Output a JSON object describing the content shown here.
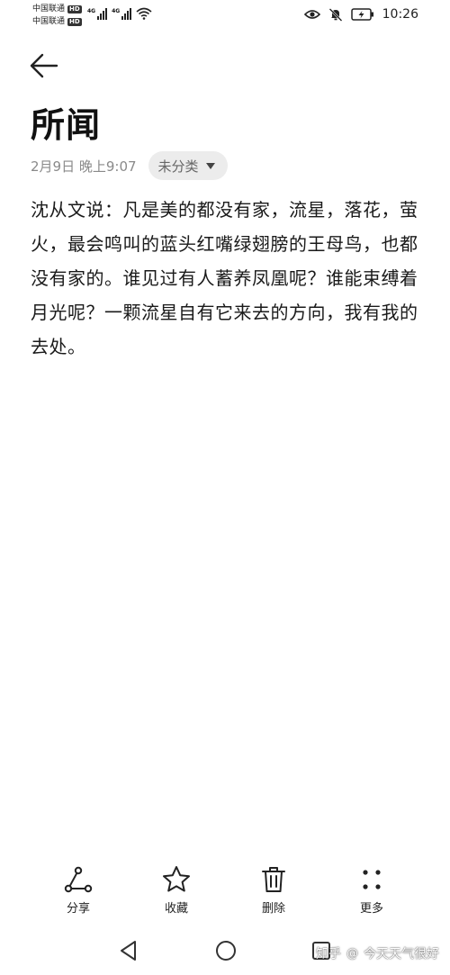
{
  "status_bar": {
    "carrier_1": "中国联通",
    "carrier_2": "中国联通",
    "hd_badge": "HD",
    "network": "4G",
    "time": "10:26"
  },
  "note": {
    "title": "所闻",
    "date": "2月9日 晚上9:07",
    "category": "未分类",
    "body": "沈从文说：凡是美的都没有家，流星，落花，萤火，最会鸣叫的蓝头红嘴绿翅膀的王母鸟，也都没有家的。谁见过有人蓄养凤凰呢？谁能束缚着月光呢？一颗流星自有它来去的方向，我有我的去处。"
  },
  "toolbar": {
    "share": "分享",
    "favorite": "收藏",
    "delete": "删除",
    "more": "更多"
  },
  "watermark": {
    "site": "知乎",
    "at": "@",
    "author": "今天天气很好"
  },
  "colors": {
    "background": "#ffffff",
    "text": "#1a1a1a",
    "meta_text": "#8a8a8a",
    "pill_bg": "#ececec"
  }
}
